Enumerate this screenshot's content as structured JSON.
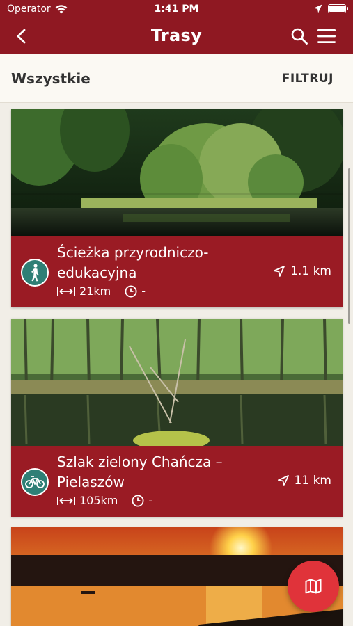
{
  "status_bar": {
    "carrier": "Operator",
    "time": "1:41 PM"
  },
  "nav": {
    "title": "Trasy"
  },
  "filter_bar": {
    "all_label": "Wszystkie",
    "filter_label": "FILTRUJ"
  },
  "routes": [
    {
      "name": "Ścieżka przyrodniczo-edukacyjna",
      "type_icon": "walking-icon",
      "distance": "1.1 km",
      "length": "21km",
      "duration": "-"
    },
    {
      "name": "Szlak zielony Chańcza – Pielaszów",
      "type_icon": "bicycle-icon",
      "distance": "11 km",
      "length": "105km",
      "duration": "-"
    },
    {
      "name": "",
      "type_icon": "",
      "distance": "",
      "length": "",
      "duration": ""
    }
  ],
  "colors": {
    "primary": "#8f1822",
    "card": "#9a1b24",
    "badge": "#2f7f76",
    "fab": "#e0333a"
  }
}
